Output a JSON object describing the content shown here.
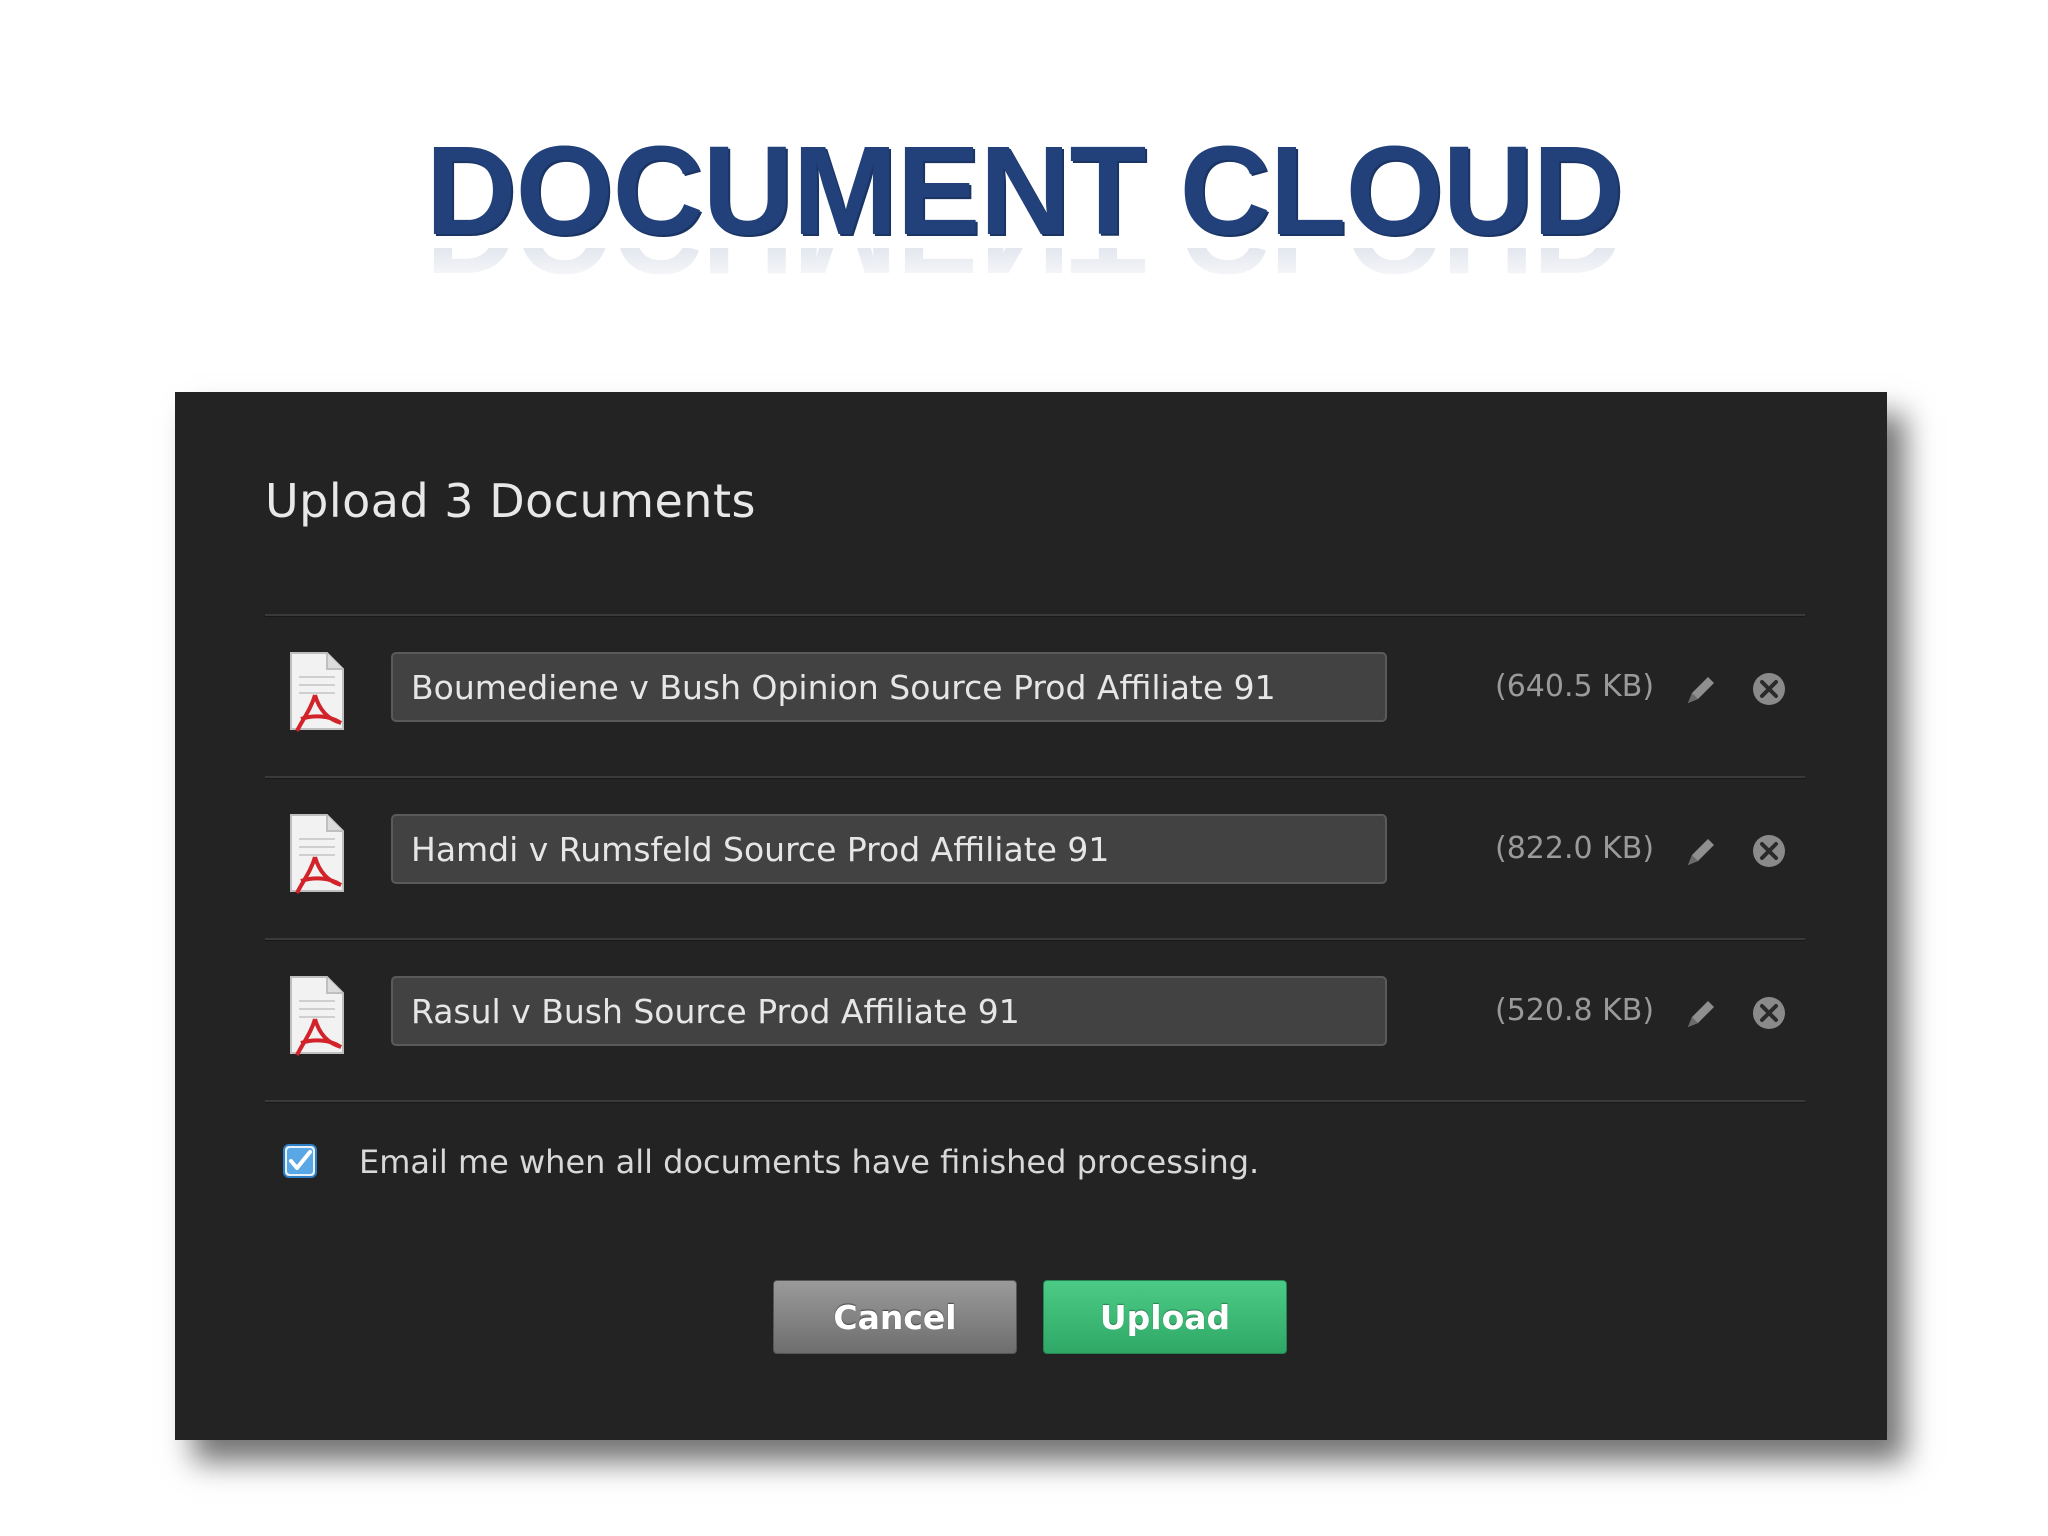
{
  "slide": {
    "title": "DOCUMENT CLOUD"
  },
  "dialog": {
    "title": "Upload 3 Documents",
    "files": [
      {
        "name": "Boumediene v Bush Opinion Source Prod Affiliate 91",
        "size": "(640.5 KB)",
        "icon": "pdf-file-icon"
      },
      {
        "name": "Hamdi v Rumsfeld Source Prod Affiliate 91",
        "size": "(822.0 KB)",
        "icon": "pdf-file-icon"
      },
      {
        "name": "Rasul v Bush Source Prod Affiliate 91",
        "size": "(520.8 KB)",
        "icon": "pdf-file-icon"
      }
    ],
    "email_option": {
      "label": "Email me when all documents have finished processing.",
      "checked": true
    },
    "buttons": {
      "cancel": "Cancel",
      "upload": "Upload"
    }
  },
  "colors": {
    "title": "#22417a",
    "dialog_bg": "#232323",
    "upload_button": "#3cbc76",
    "cancel_button": "#858585",
    "checkbox": "#4a9fe0"
  }
}
